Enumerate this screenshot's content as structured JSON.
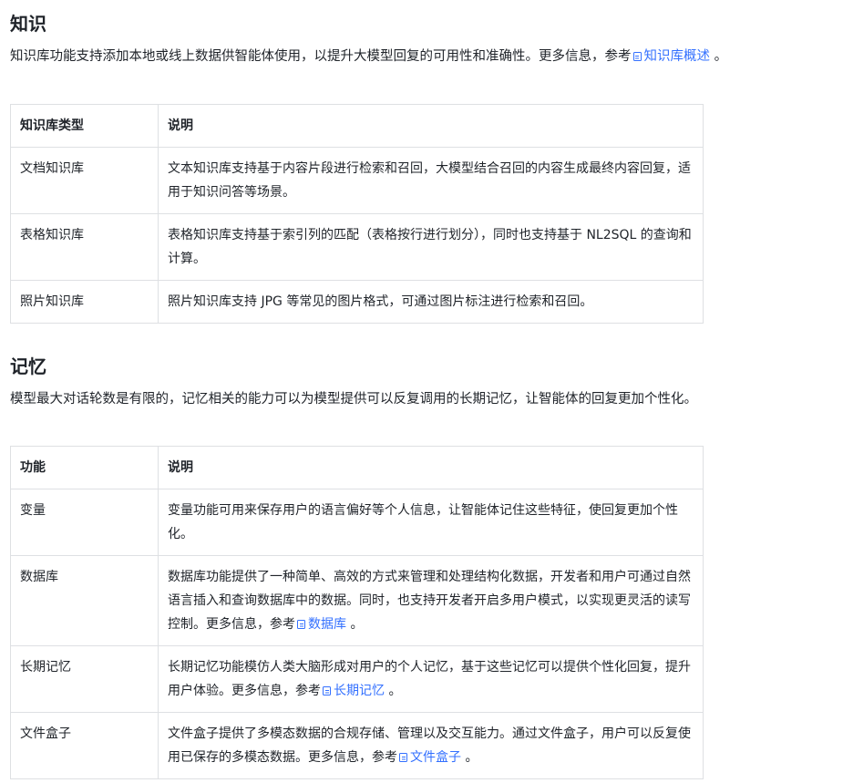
{
  "knowledge": {
    "title": "知识",
    "desc_prefix": "知识库功能支持添加本地或线上数据供智能体使用，以提升大模型回复的可用性和准确性。更多信息，参考",
    "desc_link": "知识库概述",
    "desc_suffix": " 。",
    "table": {
      "headers": [
        "知识库类型",
        "说明"
      ],
      "rows": [
        {
          "name": "文档知识库",
          "desc": "文本知识库支持基于内容片段进行检索和召回，大模型结合召回的内容生成最终内容回复，适用于知识问答等场景。"
        },
        {
          "name": "表格知识库",
          "desc": "表格知识库支持基于索引列的匹配（表格按行进行划分），同时也支持基于 NL2SQL 的查询和计算。"
        },
        {
          "name": "照片知识库",
          "desc": "照片知识库支持 JPG 等常见的图片格式，可通过图片标注进行检索和召回。"
        }
      ]
    }
  },
  "memory": {
    "title": "记忆",
    "desc": "模型最大对话轮数是有限的，记忆相关的能力可以为模型提供可以反复调用的长期记忆，让智能体的回复更加个性化。",
    "table": {
      "headers": [
        "功能",
        "说明"
      ],
      "rows": [
        {
          "name": "变量",
          "desc": "变量功能可用来保存用户的语言偏好等个人信息，让智能体记住这些特征，使回复更加个性化。",
          "link": "",
          "suffix": ""
        },
        {
          "name": "数据库",
          "desc": "数据库功能提供了一种简单、高效的方式来管理和处理结构化数据，开发者和用户可通过自然语言插入和查询数据库中的数据。同时，也支持开发者开启多用户模式，以实现更灵活的读写控制。更多信息，参考",
          "link": "数据库",
          "suffix": " 。"
        },
        {
          "name": "长期记忆",
          "desc": "长期记忆功能模仿人类大脑形成对用户的个人记忆，基于这些记忆可以提供个性化回复，提升用户体验。更多信息，参考",
          "link": "长期记忆",
          "suffix": " 。"
        },
        {
          "name": "文件盒子",
          "desc": "文件盒子提供了多模态数据的合规存储、管理以及交互能力。通过文件盒子，用户可以反复使用已保存的多模态数据。更多信息，参考",
          "link": "文件盒子",
          "suffix": " 。"
        }
      ]
    }
  },
  "colors": {
    "link": "#3370ff",
    "text": "#1f2329",
    "border": "#dee0e3"
  },
  "icons": {
    "link_icon": "document-link-icon"
  }
}
